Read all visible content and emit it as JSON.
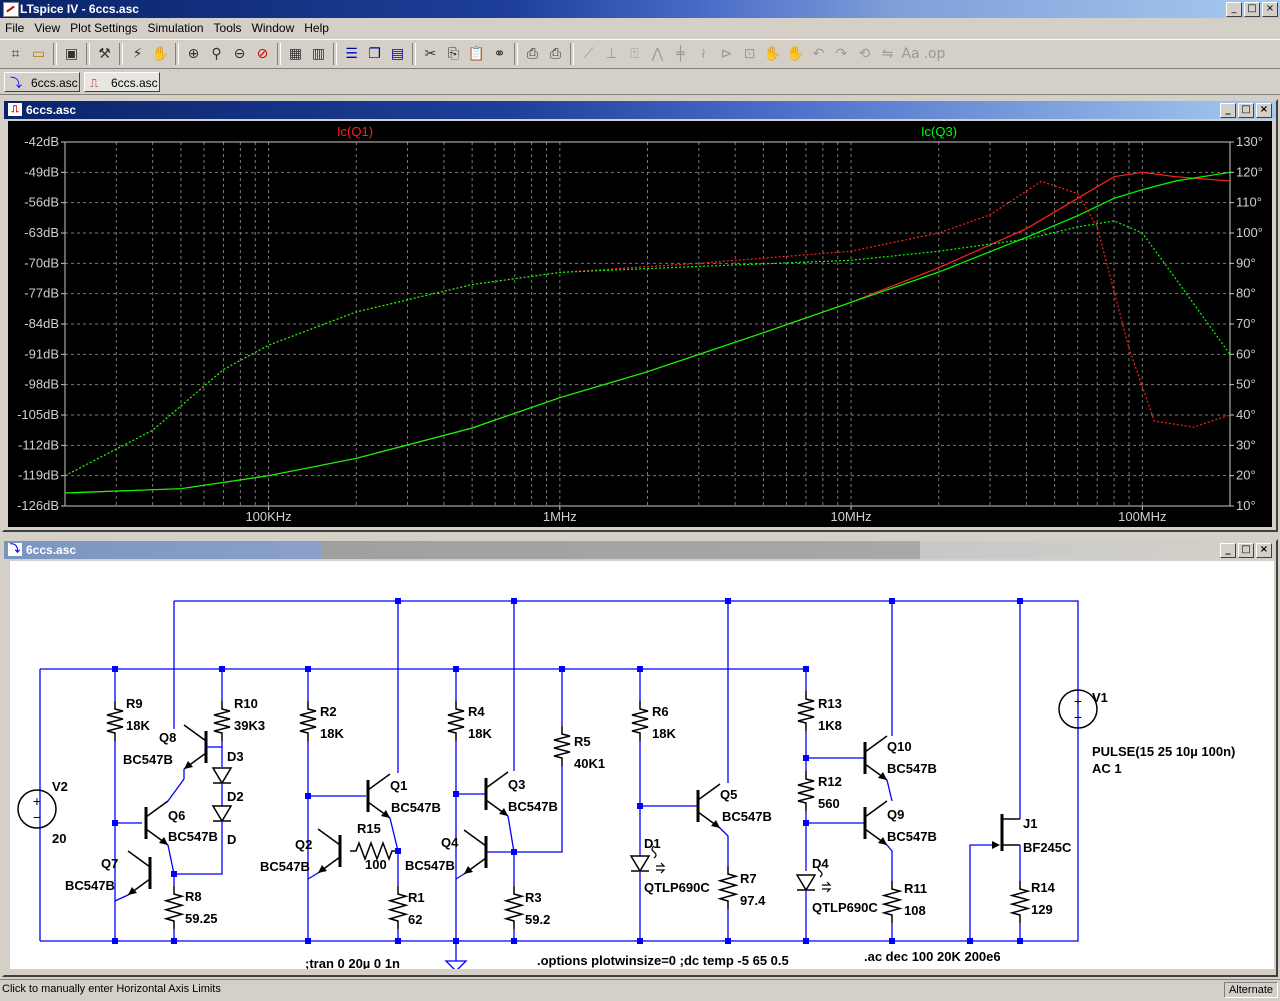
{
  "app": {
    "title": "LTspice IV - 6ccs.asc"
  },
  "menu": [
    "File",
    "View",
    "Plot Settings",
    "Simulation",
    "Tools",
    "Window",
    "Help"
  ],
  "tabs": [
    {
      "label": "6ccs.asc",
      "icon": "schematic-icon"
    },
    {
      "label": "6ccs.asc",
      "icon": "waveform-icon"
    }
  ],
  "plot_window": {
    "title": "6ccs.asc"
  },
  "schematic_window": {
    "title": "6ccs.asc"
  },
  "window_buttons": {
    "min": "_",
    "max": "□",
    "close": "×"
  },
  "status": {
    "message": "Click to manually enter Horizontal Axis Limits",
    "mode": "Alternate"
  },
  "colors": {
    "trace_q1": "#ff2020",
    "trace_q3": "#00ff00",
    "wire": "#0000ff",
    "text": "#000000"
  },
  "chart_data": {
    "type": "line",
    "title": "",
    "x_scale": "log",
    "x_range": [
      20000,
      200000000
    ],
    "x_ticks": [
      {
        "v": 100000,
        "label": "100KHz"
      },
      {
        "v": 1000000,
        "label": "1MHz"
      },
      {
        "v": 10000000,
        "label": "10MHz"
      },
      {
        "v": 100000000,
        "label": "100MHz"
      }
    ],
    "y_left_range": [
      -126,
      -42
    ],
    "y_left_ticks": [
      "-42dB",
      "-49dB",
      "-56dB",
      "-63dB",
      "-70dB",
      "-77dB",
      "-84dB",
      "-91dB",
      "-98dB",
      "-105dB",
      "-112dB",
      "-119dB",
      "-126dB"
    ],
    "y_right_range": [
      10,
      130
    ],
    "y_right_ticks": [
      "130°",
      "120°",
      "110°",
      "100°",
      "90°",
      "80°",
      "70°",
      "60°",
      "50°",
      "40°",
      "30°",
      "20°",
      "10°"
    ],
    "grid": true,
    "legend": [
      "Ic(Q1)",
      "Ic(Q3)"
    ],
    "series": [
      {
        "name": "Ic(Q1)",
        "kind": "magnitude",
        "x": [
          20000,
          50000,
          100000,
          200000,
          500000,
          1000000,
          2000000,
          5000000,
          10000000,
          20000000,
          40000000,
          60000000,
          80000000,
          100000000,
          130000000,
          200000000
        ],
        "y": [
          -123,
          -122,
          -119,
          -115,
          -108,
          -101,
          -95,
          -86,
          -79,
          -71,
          -62,
          -55,
          -50,
          -49,
          -50,
          -51
        ]
      },
      {
        "name": "Ic(Q3)",
        "kind": "magnitude",
        "x": [
          20000,
          50000,
          100000,
          200000,
          500000,
          1000000,
          2000000,
          5000000,
          10000000,
          20000000,
          40000000,
          60000000,
          80000000,
          100000000,
          130000000,
          200000000
        ],
        "y": [
          -123,
          -122,
          -119,
          -115,
          -108,
          -101,
          -95,
          -86,
          -79,
          -72,
          -64,
          -59,
          -55,
          -53,
          -51,
          -49
        ]
      },
      {
        "name": "Ic(Q1)",
        "kind": "phase",
        "x": [
          20000,
          40000,
          70000,
          100000,
          200000,
          500000,
          1000000,
          3000000,
          10000000,
          20000000,
          30000000,
          45000000,
          60000000,
          70000000,
          90000000,
          110000000,
          150000000,
          200000000
        ],
        "y": [
          20,
          35,
          55,
          63,
          74,
          83,
          87,
          90,
          94,
          100,
          106,
          117,
          113,
          102,
          62,
          38,
          36,
          40
        ]
      },
      {
        "name": "Ic(Q3)",
        "kind": "phase",
        "x": [
          20000,
          40000,
          70000,
          100000,
          200000,
          500000,
          1000000,
          3000000,
          10000000,
          20000000,
          40000000,
          60000000,
          80000000,
          100000000,
          130000000,
          200000000
        ],
        "y": [
          20,
          35,
          55,
          63,
          74,
          83,
          87,
          89,
          91,
          94,
          98,
          102,
          104,
          100,
          85,
          60
        ]
      }
    ]
  },
  "schematic": {
    "components": [
      {
        "ref": "R9",
        "value": "18K"
      },
      {
        "ref": "R10",
        "value": "39K3"
      },
      {
        "ref": "Q8",
        "value": "BC547B"
      },
      {
        "ref": "D3",
        "value": ""
      },
      {
        "ref": "D2",
        "value": "D"
      },
      {
        "ref": "Q6",
        "value": "BC547B"
      },
      {
        "ref": "Q7",
        "value": "BC547B"
      },
      {
        "ref": "R8",
        "value": "59.25"
      },
      {
        "ref": "V2",
        "value": "20"
      },
      {
        "ref": "R2",
        "value": "18K"
      },
      {
        "ref": "Q1",
        "value": "BC547B"
      },
      {
        "ref": "Q2",
        "value": "BC547B"
      },
      {
        "ref": "R15",
        "value": "100"
      },
      {
        "ref": "R1",
        "value": "62"
      },
      {
        "ref": "R4",
        "value": "18K"
      },
      {
        "ref": "Q3",
        "value": "BC547B"
      },
      {
        "ref": "Q4",
        "value": "BC547B"
      },
      {
        "ref": "R3",
        "value": "59.2"
      },
      {
        "ref": "R5",
        "value": "40K1"
      },
      {
        "ref": "R6",
        "value": "18K"
      },
      {
        "ref": "Q5",
        "value": "BC547B"
      },
      {
        "ref": "D1",
        "value": "QTLP690C"
      },
      {
        "ref": "R7",
        "value": "97.4"
      },
      {
        "ref": "R13",
        "value": "1K8"
      },
      {
        "ref": "R12",
        "value": "560"
      },
      {
        "ref": "Q10",
        "value": "BC547B"
      },
      {
        "ref": "Q9",
        "value": "BC547B"
      },
      {
        "ref": "D4",
        "value": "QTLP690C"
      },
      {
        "ref": "R11",
        "value": "108"
      },
      {
        "ref": "J1",
        "value": "BF245C"
      },
      {
        "ref": "R14",
        "value": "129"
      },
      {
        "ref": "V1",
        "value": "PULSE(15 25 10µ 100n)"
      }
    ],
    "v1_ac": "AC 1",
    "directives": [
      ";tran 0 20µ 0 1n",
      ".options plotwinsize=0  ;dc temp -5 65 0.5",
      ".ac dec 100 20K 200e6"
    ]
  }
}
